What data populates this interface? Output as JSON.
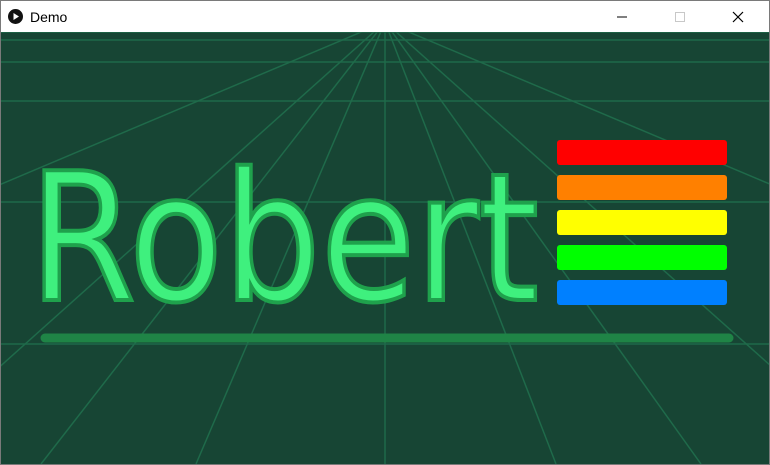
{
  "window": {
    "title": "Demo",
    "app_icon": "play-circle-icon",
    "controls": {
      "minimize_icon": "minimize-icon",
      "maximize_icon": "maximize-icon",
      "close_icon": "close-icon"
    }
  },
  "canvas": {
    "background_color": "#174534",
    "grid_color": "#1f6a4a",
    "logo": {
      "text": "Robert",
      "text_color": "#3ff07e",
      "outline_color": "#1fa14c",
      "underline_color": "#1f8446"
    },
    "stripes": [
      {
        "color": "#ff0000"
      },
      {
        "color": "#ff8000"
      },
      {
        "color": "#ffff00"
      },
      {
        "color": "#00ff00"
      },
      {
        "color": "#0080ff"
      }
    ]
  }
}
